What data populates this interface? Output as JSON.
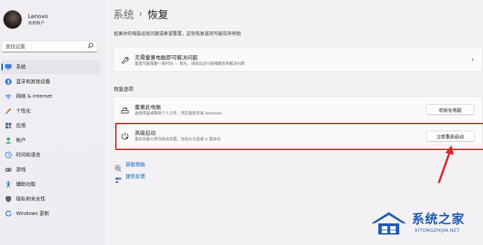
{
  "sidebar": {
    "profile": {
      "name": "Lenovo",
      "account": "本地帐户"
    },
    "search": {
      "placeholder": "查找设置"
    },
    "items": [
      {
        "label": "系统",
        "icon": "monitor-icon",
        "color": "#3a7bd5",
        "active": true
      },
      {
        "label": "蓝牙和其他设备",
        "icon": "bluetooth-icon",
        "color": "#2b6fd6"
      },
      {
        "label": "网络 & Internet",
        "icon": "wifi-icon",
        "color": "#3a7bd5"
      },
      {
        "label": "个性化",
        "icon": "brush-icon",
        "color": "#d46b2a"
      },
      {
        "label": "应用",
        "icon": "apps-icon",
        "color": "#4a5d7a"
      },
      {
        "label": "帐户",
        "icon": "person-icon",
        "color": "#2f9e6b"
      },
      {
        "label": "时间和语言",
        "icon": "globe-clock-icon",
        "color": "#2b7fd6"
      },
      {
        "label": "游戏",
        "icon": "gamepad-icon",
        "color": "#666a73"
      },
      {
        "label": "辅助功能",
        "icon": "accessibility-icon",
        "color": "#2b6fd6"
      },
      {
        "label": "隐私和安全性",
        "icon": "shield-icon",
        "color": "#5b6470"
      },
      {
        "label": "Windows 更新",
        "icon": "update-icon",
        "color": "#2b7fd6"
      }
    ]
  },
  "main": {
    "breadcrumb": {
      "parent": "系统",
      "separator": "›",
      "current": "恢复"
    },
    "description": "如果你的电脑出现问题或希望重置，这些恢复选项可能有所帮助",
    "troubleshoot": {
      "title": "无需重置电脑即可解决问题",
      "subtitle": "重置可能需要一段时间 — 首先，请尝试运行疑难解答来解决问题",
      "chevron": "›"
    },
    "recovery_section_title": "恢复选项",
    "recovery": [
      {
        "title": "重置此电脑",
        "subtitle": "选择保留或删除个人文件，然后重新安装 Windows",
        "button": "初始化电脑"
      },
      {
        "title": "高级启动",
        "subtitle": "重启设备以更改启动设置，包括从光盘或 U 盘启动",
        "button": "立即重新启动"
      }
    ],
    "links": [
      {
        "label": "获取帮助",
        "icon": "help-icon"
      },
      {
        "label": "提供反馈",
        "icon": "feedback-icon"
      }
    ]
  },
  "watermark": {
    "title": "系统之家",
    "url": "XITONGZHIJIA.NET"
  },
  "colors": {
    "accent": "#0067c0",
    "highlight": "#d9292b",
    "link": "#0061b8"
  }
}
